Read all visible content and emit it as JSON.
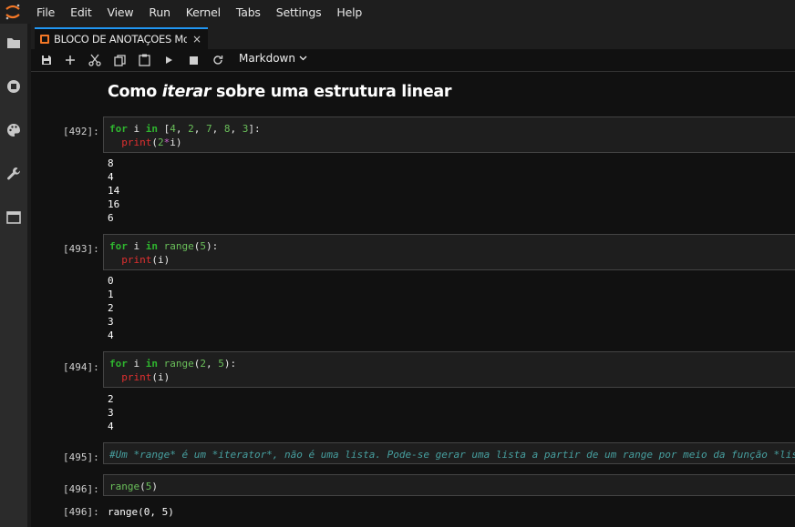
{
  "menubar": {
    "items": [
      "File",
      "Edit",
      "View",
      "Run",
      "Kernel",
      "Tabs",
      "Settings",
      "Help"
    ]
  },
  "tab": {
    "label": "BLOCO DE ANOTAÇOES Mo",
    "close": "×"
  },
  "toolbar": {
    "cell_type": "Markdown"
  },
  "notebook": {
    "title_before": "Como ",
    "title_em": "iterar",
    "title_after": " sobre uma estrutura linear",
    "cells": [
      {
        "prompt": "[492]:",
        "code_tokens": [
          [
            [
              "for",
              "kw"
            ],
            [
              " i ",
              "tx"
            ],
            [
              "in",
              "kw"
            ],
            [
              " [",
              "tx"
            ],
            [
              "4",
              "num"
            ],
            [
              ", ",
              "tx"
            ],
            [
              "2",
              "num"
            ],
            [
              ", ",
              "tx"
            ],
            [
              "7",
              "num"
            ],
            [
              ", ",
              "tx"
            ],
            [
              "8",
              "num"
            ],
            [
              ", ",
              "tx"
            ],
            [
              "3",
              "num"
            ],
            [
              "]:",
              "tx"
            ]
          ],
          [
            [
              "  ",
              "tx"
            ],
            [
              "print",
              "bi"
            ],
            [
              "(",
              "tx"
            ],
            [
              "2",
              "num"
            ],
            [
              "*",
              "op"
            ],
            [
              "i)",
              "tx"
            ]
          ]
        ],
        "output": [
          "8",
          "4",
          "14",
          "16",
          "6"
        ]
      },
      {
        "prompt": "[493]:",
        "code_tokens": [
          [
            [
              "for",
              "kw"
            ],
            [
              " i ",
              "tx"
            ],
            [
              "in",
              "kw"
            ],
            [
              " ",
              "tx"
            ],
            [
              "range",
              "num"
            ],
            [
              "(",
              "tx"
            ],
            [
              "5",
              "num"
            ],
            [
              "):",
              "tx"
            ]
          ],
          [
            [
              "  ",
              "tx"
            ],
            [
              "print",
              "bi"
            ],
            [
              "(i)",
              "tx"
            ]
          ]
        ],
        "output": [
          "0",
          "1",
          "2",
          "3",
          "4"
        ]
      },
      {
        "prompt": "[494]:",
        "code_tokens": [
          [
            [
              "for",
              "kw"
            ],
            [
              " i ",
              "tx"
            ],
            [
              "in",
              "kw"
            ],
            [
              " ",
              "tx"
            ],
            [
              "range",
              "num"
            ],
            [
              "(",
              "tx"
            ],
            [
              "2",
              "num"
            ],
            [
              ", ",
              "tx"
            ],
            [
              "5",
              "num"
            ],
            [
              "):",
              "tx"
            ]
          ],
          [
            [
              "  ",
              "tx"
            ],
            [
              "print",
              "bi"
            ],
            [
              "(i)",
              "tx"
            ]
          ]
        ],
        "output": [
          "2",
          "3",
          "4"
        ]
      },
      {
        "prompt": "[495]:",
        "code_tokens": [
          [
            [
              "#Um *range* é um *iterator*, não é uma lista. Pode-se gerar uma lista a partir de um range por meio da função *list*.",
              "cm"
            ]
          ]
        ],
        "output": []
      },
      {
        "prompt": "[496]:",
        "code_tokens": [
          [
            [
              "range",
              "num"
            ],
            [
              "(",
              "tx"
            ],
            [
              "5",
              "num"
            ],
            [
              ")",
              "tx"
            ]
          ]
        ],
        "output": []
      }
    ],
    "final_output": {
      "prompt": "[496]:",
      "text": "range(0, 5)"
    }
  },
  "icons": {
    "sidebar": [
      "folder-icon",
      "running-icon",
      "palette-icon",
      "wrench-icon",
      "tabs-icon"
    ],
    "toolbar": [
      "save-icon",
      "add-cell-icon",
      "cut-icon",
      "copy-icon",
      "paste-icon",
      "run-icon",
      "stop-icon",
      "restart-icon"
    ]
  },
  "colors": {
    "accent": "#2196f3",
    "brand": "#f37726",
    "keyword": "#2fb62f",
    "builtin": "#e03030",
    "comment": "#47a0a0"
  }
}
